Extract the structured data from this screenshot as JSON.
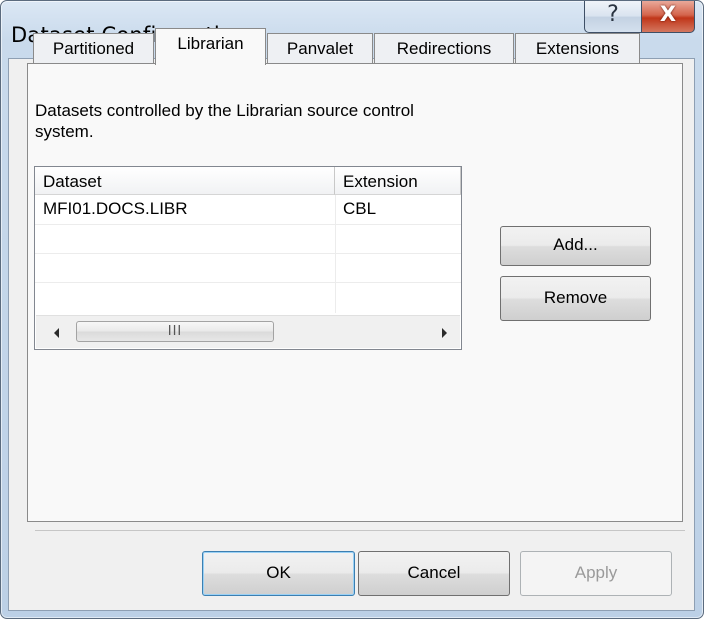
{
  "window": {
    "title": "Dataset Configuration",
    "help_glyph": "?",
    "close_glyph": "X"
  },
  "tabs": [
    {
      "label": "Partitioned"
    },
    {
      "label": "Librarian",
      "active": true
    },
    {
      "label": "Panvalet"
    },
    {
      "label": "Redirections"
    },
    {
      "label": "Extensions"
    }
  ],
  "description": "Datasets controlled by the Librarian source control system.",
  "list": {
    "columns": [
      "Dataset",
      "Extension"
    ],
    "rows": [
      {
        "dataset": "MFI01.DOCS.LIBR",
        "extension": "CBL"
      }
    ],
    "scroll_grip": "III"
  },
  "side_buttons": {
    "add": "Add...",
    "remove": "Remove"
  },
  "footer_buttons": {
    "ok": "OK",
    "cancel": "Cancel",
    "apply": "Apply"
  }
}
